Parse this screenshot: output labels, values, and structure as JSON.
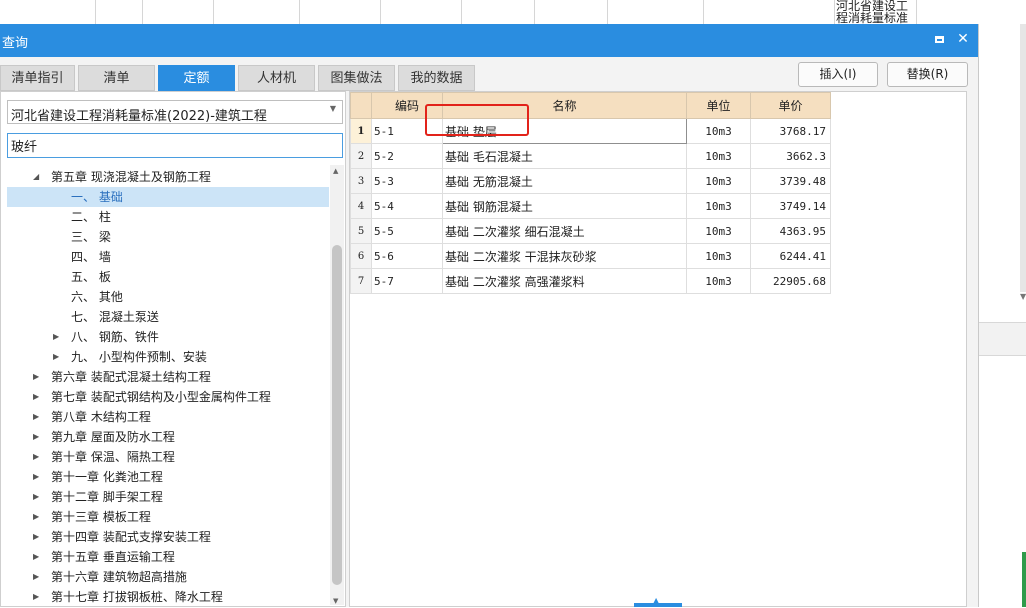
{
  "background": {
    "cell_text": "河北省建设工程消耗量标准"
  },
  "dialog": {
    "title": "查询",
    "tabs": [
      {
        "label": "清单指引"
      },
      {
        "label": "清单"
      },
      {
        "label": "定额",
        "active": true
      },
      {
        "label": "人材机"
      },
      {
        "label": "图集做法"
      },
      {
        "label": "我的数据"
      }
    ],
    "buttons": {
      "insert": "插入(I)",
      "replace": "替换(R)"
    },
    "left": {
      "standard_select": "河北省建设工程消耗量标准(2022)-建筑工程",
      "search_value": "玻纤",
      "tree": [
        {
          "label": "第五章 现浇混凝土及钢筋工程",
          "expanded": true
        },
        {
          "label": "一、 基础",
          "selected": true
        },
        {
          "label": "二、 柱"
        },
        {
          "label": "三、 梁"
        },
        {
          "label": "四、 墙"
        },
        {
          "label": "五、 板"
        },
        {
          "label": "六、 其他"
        },
        {
          "label": "七、 混凝土泵送"
        },
        {
          "label": "八、 钢筋、铁件",
          "expandable": true
        },
        {
          "label": "九、 小型构件预制、安装",
          "expandable": true
        },
        {
          "label": "第六章 装配式混凝土结构工程",
          "expandable": true
        },
        {
          "label": "第七章 装配式钢结构及小型金属构件工程",
          "expandable": true
        },
        {
          "label": "第八章 木结构工程",
          "expandable": true
        },
        {
          "label": "第九章 屋面及防水工程",
          "expandable": true
        },
        {
          "label": "第十章 保温、隔热工程",
          "expandable": true
        },
        {
          "label": "第十一章 化粪池工程",
          "expandable": true
        },
        {
          "label": "第十二章 脚手架工程",
          "expandable": true
        },
        {
          "label": "第十三章 模板工程",
          "expandable": true
        },
        {
          "label": "第十四章 装配式支撑安装工程",
          "expandable": true
        },
        {
          "label": "第十五章 垂直运输工程",
          "expandable": true
        },
        {
          "label": "第十六章 建筑物超高措施",
          "expandable": true
        },
        {
          "label": "第十七章 打拔钢板桩、降水工程",
          "expandable": true
        }
      ]
    },
    "table": {
      "headers": {
        "code": "编码",
        "name": "名称",
        "unit": "单位",
        "price": "单价"
      },
      "rows": [
        {
          "no": "1",
          "code": "5-1",
          "name": "基础 垫层",
          "unit": "10m3",
          "price": "3768.17"
        },
        {
          "no": "2",
          "code": "5-2",
          "name": "基础 毛石混凝土",
          "unit": "10m3",
          "price": "3662.3"
        },
        {
          "no": "3",
          "code": "5-3",
          "name": "基础 无筋混凝土",
          "unit": "10m3",
          "price": "3739.48"
        },
        {
          "no": "4",
          "code": "5-4",
          "name": "基础 钢筋混凝土",
          "unit": "10m3",
          "price": "3749.14"
        },
        {
          "no": "5",
          "code": "5-5",
          "name": "基础 二次灌浆 细石混凝土",
          "unit": "10m3",
          "price": "4363.95"
        },
        {
          "no": "6",
          "code": "5-6",
          "name": "基础 二次灌浆 干混抹灰砂浆",
          "unit": "10m3",
          "price": "6244.41"
        },
        {
          "no": "7",
          "code": "5-7",
          "name": "基础 二次灌浆 高强灌浆料",
          "unit": "10m3",
          "price": "22905.68"
        }
      ]
    }
  }
}
